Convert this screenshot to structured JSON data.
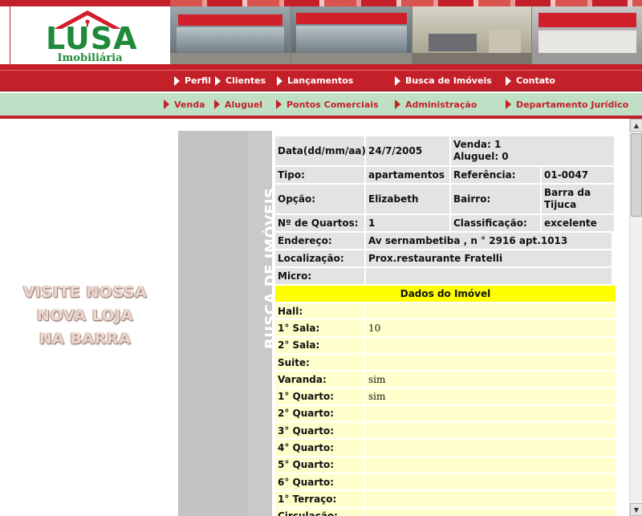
{
  "brand": {
    "name": "LUSA",
    "subtitle": "Imobiliária"
  },
  "nav_primary": [
    {
      "label": "Perfil"
    },
    {
      "label": "Clientes"
    },
    {
      "label": "Lançamentos"
    },
    {
      "label": "Busca de Imóveis"
    },
    {
      "label": "Contato"
    }
  ],
  "nav_secondary": [
    {
      "label": "Venda"
    },
    {
      "label": "Aluguel"
    },
    {
      "label": "Pontos Comerciais"
    },
    {
      "label": "Administração"
    },
    {
      "label": "Departamento Jurídico"
    }
  ],
  "promo": {
    "line1": "VISITE NOSSA",
    "line2": "NOVA LOJA",
    "line3": "NA BARRA"
  },
  "side_title": "BUSCA DE IMÓVEIS",
  "details": {
    "date_label": "Data(dd/mm/aa):",
    "date_value": "24/7/2005",
    "venda_label": "Venda: 1",
    "aluguel_label": "Aluguel: 0",
    "tipo_label": "Tipo:",
    "tipo_value": "apartamentos",
    "referencia_label": "Referência:",
    "referencia_value": "01-0047",
    "opcao_label": "Opção:",
    "opcao_value": "Elizabeth",
    "bairro_label": "Bairro:",
    "bairro_value": "Barra da Tijuca",
    "quartos_label": "Nº de Quartos:",
    "quartos_value": "1",
    "classificacao_label": "Classificação:",
    "classificacao_value": "excelente",
    "endereco_label": "Endereço:",
    "endereco_value": "Av sernambetiba , n ° 2916 apt.1013",
    "localizacao_label": "Localização:",
    "localizacao_value": "Prox.restaurante Fratelli",
    "micro_label": "Micro:",
    "micro_value": ""
  },
  "dados": {
    "heading": "Dados do Imóvel",
    "fields": [
      {
        "label": "Hall:",
        "value": ""
      },
      {
        "label": "1° Sala:",
        "value": "10"
      },
      {
        "label": "2° Sala:",
        "value": ""
      },
      {
        "label": "Suite:",
        "value": ""
      },
      {
        "label": "Varanda:",
        "value": "sim"
      },
      {
        "label": "1° Quarto:",
        "value": "sim"
      },
      {
        "label": "2° Quarto:",
        "value": ""
      },
      {
        "label": "3° Quarto:",
        "value": ""
      },
      {
        "label": "4° Quarto:",
        "value": ""
      },
      {
        "label": "5° Quarto:",
        "value": ""
      },
      {
        "label": "6° Quarto:",
        "value": ""
      },
      {
        "label": "1° Terraço:",
        "value": ""
      },
      {
        "label": "Circulação:",
        "value": ""
      }
    ]
  },
  "colors": {
    "brand_red": "#c4202a",
    "brand_green": "#1f8a3a",
    "nav_green": "#bfe0c4",
    "highlight_yellow": "#ffff00",
    "field_yellow": "#ffffcc"
  }
}
